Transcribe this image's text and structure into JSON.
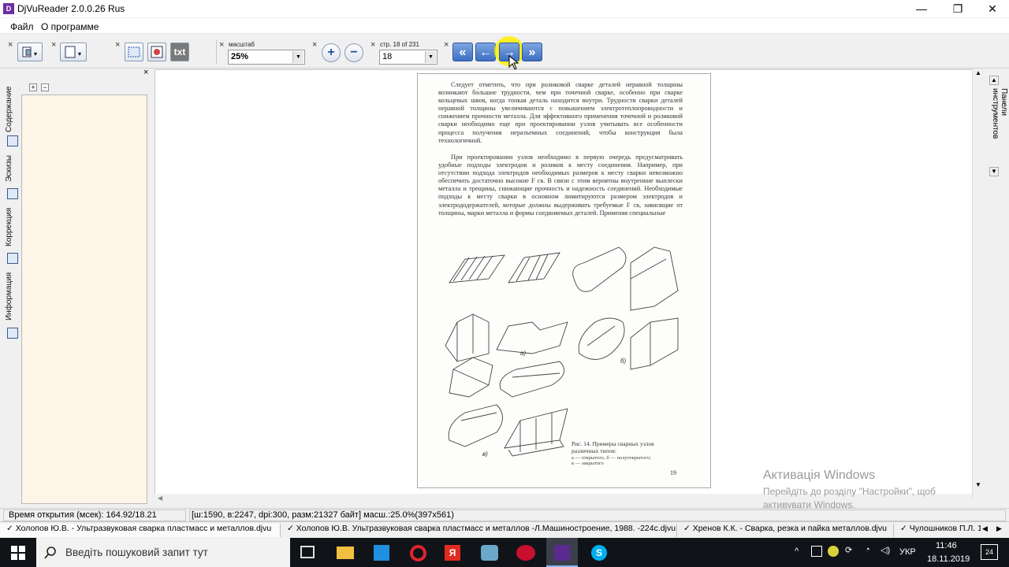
{
  "window": {
    "title": "DjVuReader 2.0.0.26 Rus",
    "controls": {
      "minimize": "—",
      "maximize": "❐",
      "close": "✕"
    }
  },
  "menu": {
    "items": [
      "Файл",
      "О программе"
    ]
  },
  "toolbar": {
    "zoom_label": "масштаб",
    "zoom_value": "25%",
    "page_label": "стр. 18 of 231",
    "page_value": "18",
    "txt_label": "txt",
    "nav": {
      "first": "«",
      "prev": "←",
      "next": "→",
      "last": "»"
    },
    "zoom_in": "+",
    "zoom_out": "−"
  },
  "sidebar": {
    "tabs": [
      "Содержание",
      "Эскизы",
      "Коррекция",
      "Информация"
    ],
    "expand": "+",
    "collapse": "−"
  },
  "page": {
    "paragraph1": "Следует отметить, что при роликовой сварке деталей неравной толщины возникают бо́льшие трудности, чем при точечной сварке, особенно при сварке кольцевых швов, когда тонкая деталь находится внутри. Трудности сварки деталей неравной толщины увеличиваются с повышением электротеплопроводности и снижением прочности металла. Для эффективного применения точечной и роликовой сварки необходимо еще при проектировании узлов учитывать все особенности процесса получения неразъемных соединений, чтобы конструкция была технологичной.",
    "paragraph2": "При проектировании узлов необходимо в первую очередь предусматривать удобные подходы электродов и роликов к месту соединения. Например, при отсутствии подхода электродов необходимых размеров к месту сварки невозможно обеспечить достаточно высокие F св. В связи с этим вероятны внутренние выплески металла и трещины, снижающие прочность и надежность соединений. Необходимые подходы к месту сварки в основном лимитируются размером электродов и электрододержателей, которые должны выдерживать требуемые F св, зависящие от толщины, марки металла и формы соединяемых деталей. Применяя специальные",
    "caption": "Рис. 14. Примеры сварных узлов различных типов:",
    "caption2": "а — открытого,    б — полуоткрытого;",
    "caption3": "в — закрытого",
    "fig_a": "а)",
    "fig_b": "б)",
    "fig_c": "в)",
    "number": "19"
  },
  "right_panel": {
    "label": "Панели инструментов"
  },
  "status": {
    "open_time": "Время открытия (мсек): 164.92/18.21",
    "info": "[ш:1590, в:2247, dpi:300, разм:21327 байт] масш.:25.0%(397x561)"
  },
  "doc_tabs": [
    "Холопов Ю.В. - Ультразвуковая сварка пластмасс и металлов.djvu",
    "Холопов Ю.В. Ультразвуковая сварка пластмасс и металлов -Л.Машиностроение, 1988. -224с.djvu",
    "Хренов К.К. - Сварка, резка и пайка металлов.djvu",
    "Чулошников П.Л. 1"
  ],
  "activation": {
    "title": "Активація Windows",
    "line1": "Перейдіть до розділу \"Настройки\", щоб",
    "line2": "активувати Windows."
  },
  "taskbar": {
    "search_placeholder": "Введіть пошуковий запит тут",
    "lang": "УКР",
    "time": "11:46",
    "date": "18.11.2019",
    "notif": "24"
  }
}
